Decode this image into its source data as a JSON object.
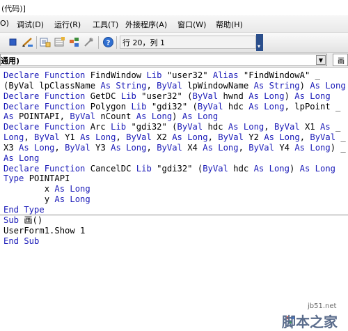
{
  "window": {
    "title": "(代码)]"
  },
  "menu": [
    {
      "label": "O)",
      "name": "menu-view-partial"
    },
    {
      "label": "调试(D)",
      "name": "menu-debug"
    },
    {
      "label": "运行(R)",
      "name": "menu-run"
    },
    {
      "label": "工具(T)",
      "name": "menu-tools"
    },
    {
      "label": "外接程序(A)",
      "name": "menu-addins"
    },
    {
      "label": "窗口(W)",
      "name": "menu-window"
    },
    {
      "label": "帮助(H)",
      "name": "menu-help"
    }
  ],
  "toolbar": {
    "position_text": "行 20，列 1",
    "overflow_glyph": "▾"
  },
  "combo": {
    "object_value": "通用)",
    "proc_value": "画"
  },
  "code": [
    [
      [
        "k",
        "Declare Function "
      ],
      [
        "t",
        "FindWindow "
      ],
      [
        "k",
        "Lib "
      ],
      [
        "t",
        "\"user32\" "
      ],
      [
        "k",
        "Alias "
      ],
      [
        "t",
        "\"FindWindowA\" _"
      ]
    ],
    [
      [
        "t",
        "(ByVal lpClassName "
      ],
      [
        "k",
        "As String"
      ],
      [
        "t",
        ", "
      ],
      [
        "k",
        "ByVal "
      ],
      [
        "t",
        "lpWindowName "
      ],
      [
        "k",
        "As String"
      ],
      [
        "t",
        ") "
      ],
      [
        "k",
        "As Long"
      ]
    ],
    [
      [
        "k",
        "Declare Function "
      ],
      [
        "t",
        "GetDC "
      ],
      [
        "k",
        "Lib "
      ],
      [
        "t",
        "\"user32\" ("
      ],
      [
        "k",
        "ByVal "
      ],
      [
        "t",
        "hwnd "
      ],
      [
        "k",
        "As Long"
      ],
      [
        "t",
        ") "
      ],
      [
        "k",
        "As Long"
      ]
    ],
    [
      [
        "k",
        "Declare Function "
      ],
      [
        "t",
        "Polygon "
      ],
      [
        "k",
        "Lib "
      ],
      [
        "t",
        "\"gdi32\" ("
      ],
      [
        "k",
        "ByVal "
      ],
      [
        "t",
        "hdc "
      ],
      [
        "k",
        "As Long"
      ],
      [
        "t",
        ", lpPoint _"
      ]
    ],
    [
      [
        "k",
        "As "
      ],
      [
        "t",
        "POINTAPI, "
      ],
      [
        "k",
        "ByVal "
      ],
      [
        "t",
        "nCount "
      ],
      [
        "k",
        "As Long"
      ],
      [
        "t",
        ") "
      ],
      [
        "k",
        "As Long"
      ]
    ],
    [
      [
        "k",
        "Declare Function "
      ],
      [
        "t",
        "Arc "
      ],
      [
        "k",
        "Lib "
      ],
      [
        "t",
        "\"gdi32\" ("
      ],
      [
        "k",
        "ByVal "
      ],
      [
        "t",
        "hdc "
      ],
      [
        "k",
        "As Long"
      ],
      [
        "t",
        ", "
      ],
      [
        "k",
        "ByVal "
      ],
      [
        "t",
        "X1 "
      ],
      [
        "k",
        "As "
      ],
      [
        "t",
        "_"
      ]
    ],
    [
      [
        "k",
        "Long"
      ],
      [
        "t",
        ", "
      ],
      [
        "k",
        "ByVal "
      ],
      [
        "t",
        "Y1 "
      ],
      [
        "k",
        "As Long"
      ],
      [
        "t",
        ", "
      ],
      [
        "k",
        "ByVal "
      ],
      [
        "t",
        "X2 "
      ],
      [
        "k",
        "As Long"
      ],
      [
        "t",
        ", "
      ],
      [
        "k",
        "ByVal "
      ],
      [
        "t",
        "Y2 "
      ],
      [
        "k",
        "As Long"
      ],
      [
        "t",
        ", "
      ],
      [
        "k",
        "ByVal "
      ],
      [
        "t",
        "_"
      ]
    ],
    [
      [
        "t",
        "X3 "
      ],
      [
        "k",
        "As Long"
      ],
      [
        "t",
        ", "
      ],
      [
        "k",
        "ByVal "
      ],
      [
        "t",
        "Y3 "
      ],
      [
        "k",
        "As Long"
      ],
      [
        "t",
        ", "
      ],
      [
        "k",
        "ByVal "
      ],
      [
        "t",
        "X4 "
      ],
      [
        "k",
        "As Long"
      ],
      [
        "t",
        ", "
      ],
      [
        "k",
        "ByVal "
      ],
      [
        "t",
        "Y4 "
      ],
      [
        "k",
        "As Long"
      ],
      [
        "t",
        ") _"
      ]
    ],
    [
      [
        "k",
        "As Long"
      ]
    ],
    [
      [
        "k",
        "Declare Function "
      ],
      [
        "t",
        "CancelDC "
      ],
      [
        "k",
        "Lib "
      ],
      [
        "t",
        "\"gdi32\" ("
      ],
      [
        "k",
        "ByVal "
      ],
      [
        "t",
        "hdc "
      ],
      [
        "k",
        "As Long"
      ],
      [
        "t",
        ") "
      ],
      [
        "k",
        "As Long"
      ]
    ],
    [
      [
        "k",
        "Type "
      ],
      [
        "t",
        "POINTAPI"
      ]
    ],
    [
      [
        "t",
        "        x "
      ],
      [
        "k",
        "As Long"
      ]
    ],
    [
      [
        "t",
        "        y "
      ],
      [
        "k",
        "As Long"
      ]
    ],
    [
      [
        "k",
        "End Type"
      ]
    ],
    [
      [
        "k",
        "Sub "
      ],
      [
        "t",
        "画()"
      ]
    ],
    [
      [
        "t",
        "UserForm1.Show 1"
      ]
    ],
    [
      [
        "k",
        "End Sub"
      ]
    ]
  ],
  "watermark": {
    "url": "jb51.net",
    "brand": "脚本之家"
  },
  "colors": {
    "keyword": "#1a1ab8",
    "text": "#000000",
    "overflow": "#2b4f8c"
  }
}
